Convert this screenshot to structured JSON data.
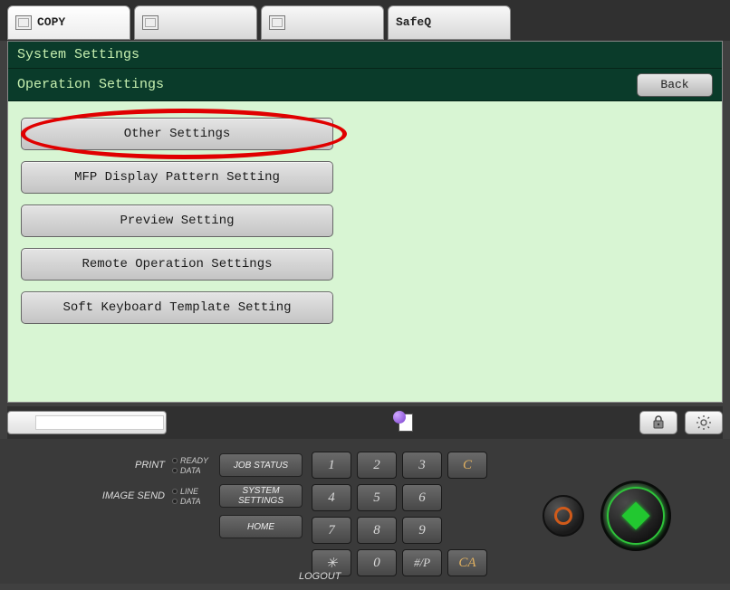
{
  "tabs": {
    "copy": "COPY",
    "tab2": "",
    "tab3": "",
    "safeq": "SafeQ"
  },
  "titles": {
    "system": "System Settings",
    "operation": "Operation Settings"
  },
  "buttons": {
    "back": "Back"
  },
  "options": {
    "other": "Other Settings",
    "display": "MFP Display Pattern Setting",
    "preview": "Preview Setting",
    "remote": "Remote Operation Settings",
    "softkb": "Soft Keyboard Template Setting"
  },
  "hw": {
    "print": "PRINT",
    "imagesend": "IMAGE SEND",
    "ready": "READY",
    "data": "DATA",
    "line": "LINE",
    "data2": "DATA",
    "jobstatus": "JOB STATUS",
    "system": "SYSTEM SETTINGS",
    "home": "HOME",
    "logout": "LOGOUT"
  },
  "keypad": {
    "k1": "1",
    "k2": "2",
    "k3": "3",
    "kc": "C",
    "k4": "4",
    "k5": "5",
    "k6": "6",
    "k7": "7",
    "k8": "8",
    "k9": "9",
    "kstar": "✳",
    "k0": "0",
    "khash": "#/P",
    "kca": "CA"
  }
}
